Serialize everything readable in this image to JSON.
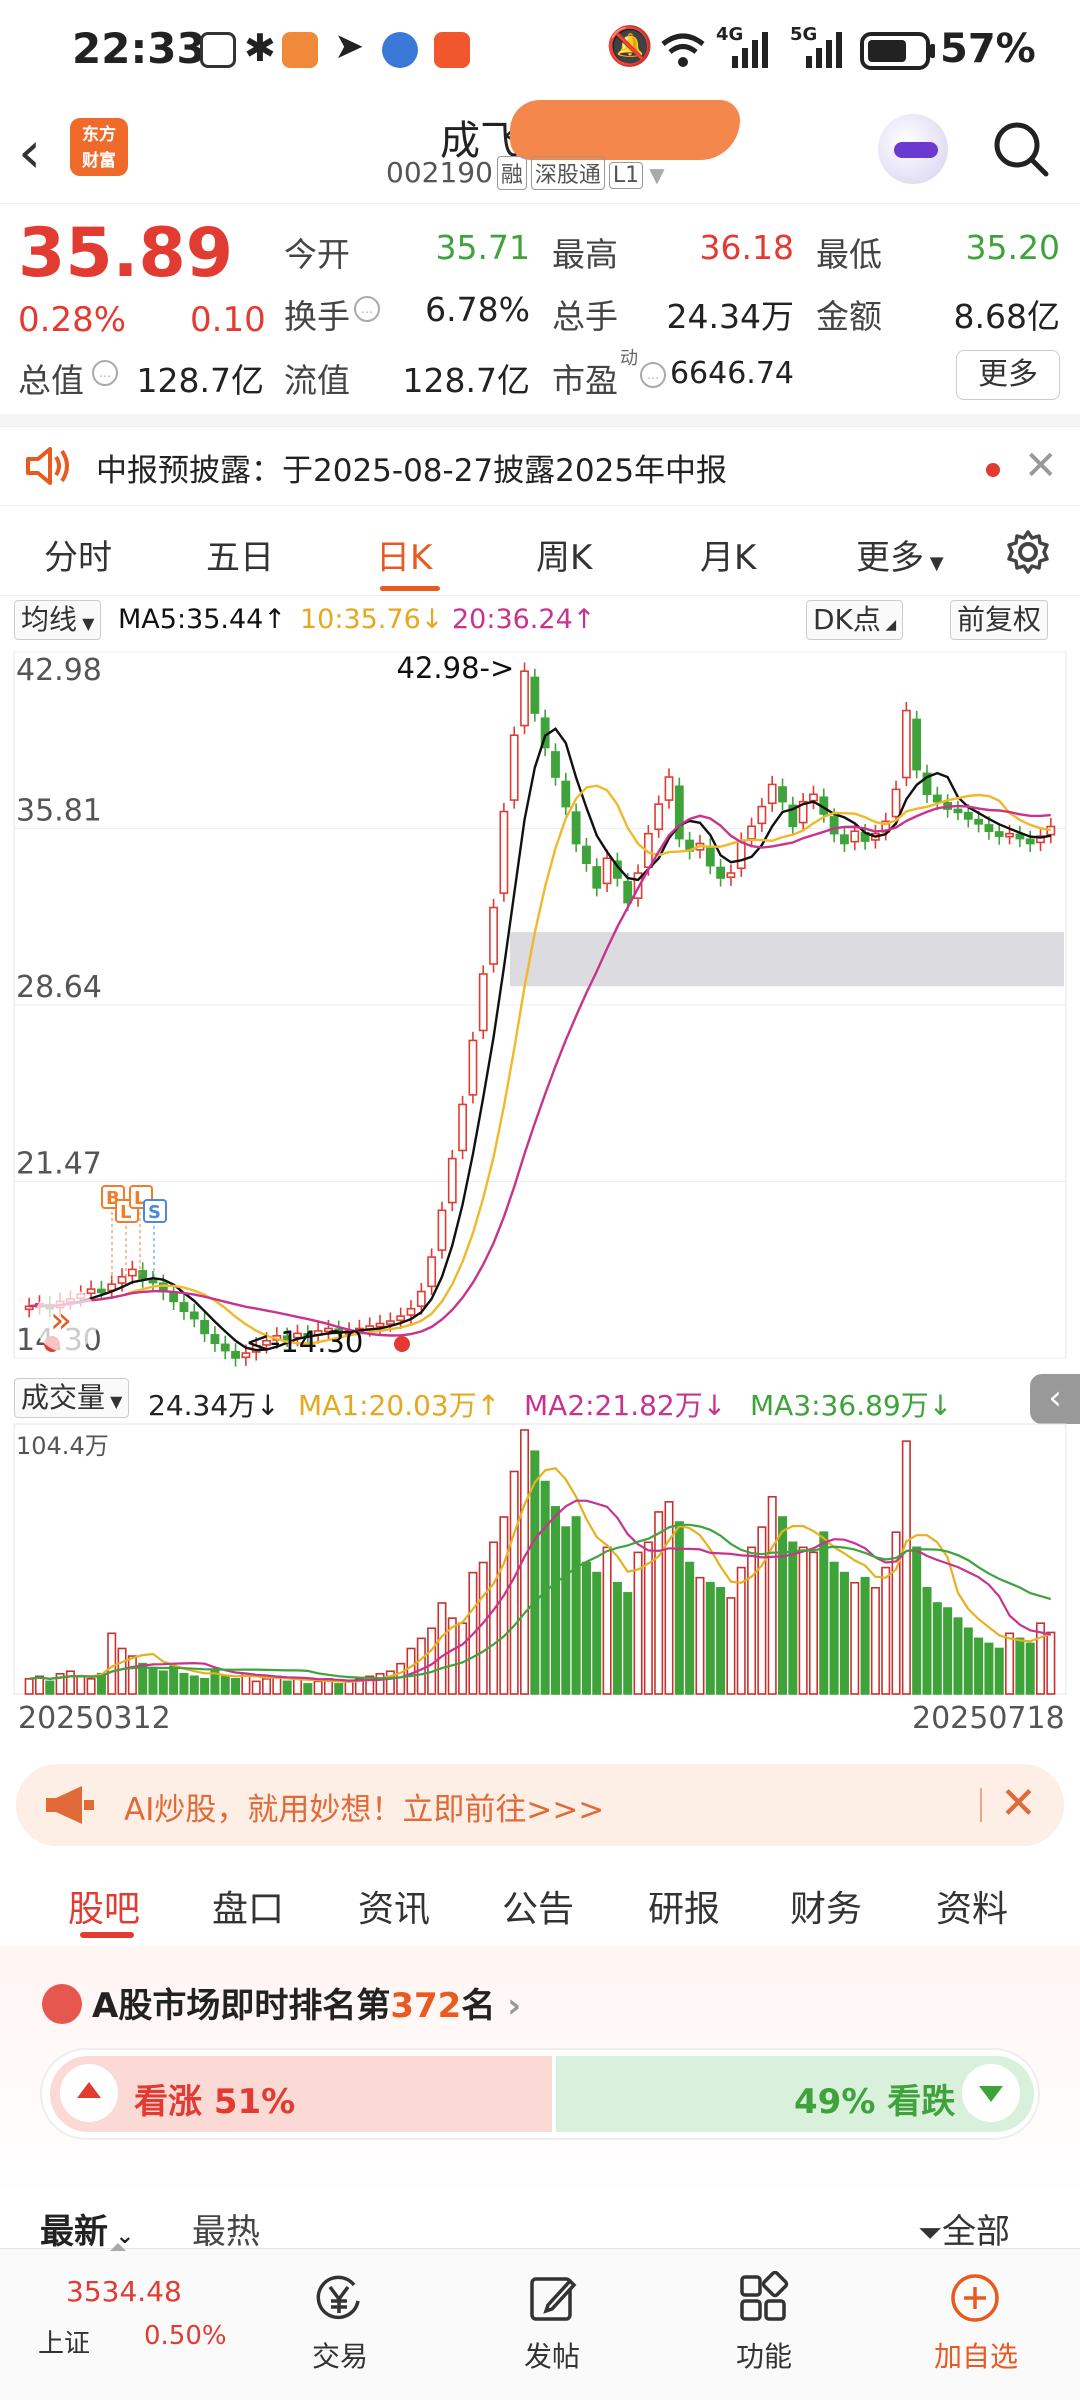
{
  "status_bar": {
    "time": "22:33",
    "network_labels": [
      "4G",
      "5G"
    ],
    "battery": "57%"
  },
  "header": {
    "logo_line1": "东方",
    "logo_line2": "财富",
    "stock_name": "成飞",
    "stock_code": "002190",
    "tags": [
      "融",
      "深股通",
      "L1"
    ]
  },
  "quote": {
    "price": "35.89",
    "change_pct": "0.28%",
    "change": "0.10",
    "open_label": "今开",
    "open": "35.71",
    "high_label": "最高",
    "high": "36.18",
    "low_label": "最低",
    "low": "35.20",
    "turnover_label": "换手",
    "turnover": "6.78%",
    "volume_label": "总手",
    "volume": "24.34万",
    "amount_label": "金额",
    "amount": "8.68亿",
    "mktcap_label": "总值",
    "mktcap": "128.7亿",
    "float_label": "流值",
    "float_cap": "128.7亿",
    "pe_label": "市盈",
    "pe_sup": "动",
    "pe": "6646.74",
    "more": "更多"
  },
  "notice": {
    "text": "中报预披露：于2025-08-27披露2025年中报"
  },
  "period_tabs": [
    "分时",
    "五日",
    "日K",
    "周K",
    "月K",
    "更多"
  ],
  "active_period": "日K",
  "ma_row": {
    "type_label": "均线",
    "ma5": "MA5:35.44",
    "ma10": "10:35.76",
    "ma20": "20:36.24",
    "dk": "DK点",
    "adjust": "前复权"
  },
  "chart_data": [
    {
      "type": "candlestick",
      "y_axis_ticks": [
        "42.98",
        "35.81",
        "28.64",
        "21.47",
        "14.30"
      ],
      "ylim": [
        14.3,
        42.98
      ],
      "x_start": "20250312",
      "x_end": "20250718",
      "max_annotation": "42.98->",
      "min_annotation": "<-14.30",
      "trade_markers": [
        "B",
        "L",
        "L",
        "S"
      ],
      "closes": [
        16.4,
        16.5,
        16.3,
        16.6,
        16.7,
        16.9,
        17.1,
        17.0,
        17.3,
        17.6,
        17.9,
        17.5,
        17.4,
        17.0,
        16.6,
        16.2,
        15.9,
        15.3,
        14.9,
        14.6,
        14.3,
        14.5,
        14.8,
        15.0,
        15.2,
        15.1,
        15.3,
        15.2,
        15.4,
        15.5,
        15.3,
        15.4,
        15.5,
        15.6,
        15.7,
        15.8,
        16.0,
        16.3,
        17.0,
        18.4,
        20.3,
        22.4,
        24.6,
        27.2,
        29.9,
        32.6,
        36.5,
        39.6,
        42.2,
        40.5,
        39.1,
        37.9,
        36.7,
        35.2,
        34.4,
        33.4,
        34.6,
        33.8,
        32.8,
        34.0,
        35.6,
        36.8,
        37.9,
        35.4,
        34.9,
        35.2,
        34.3,
        33.8,
        34.0,
        35.3,
        35.9,
        36.7,
        37.6,
        36.9,
        35.9,
        36.9,
        37.2,
        36.4,
        35.6,
        35.2,
        35.7,
        35.3,
        35.6,
        36.1,
        37.4,
        40.6,
        38.2,
        37.2,
        36.9,
        36.6,
        36.5,
        36.2,
        36.0,
        35.7,
        35.5,
        35.6,
        35.4,
        35.2,
        35.5,
        35.89
      ],
      "ma_series": [
        "MA5",
        "MA10",
        "MA20"
      ]
    },
    {
      "type": "bar",
      "title": "成交量",
      "current": "24.34万",
      "ma1": "MA1:20.03万",
      "ma2": "MA2:21.82万",
      "ma3": "MA3:36.89万",
      "max_label": "104.4万",
      "values": [
        6,
        7,
        5,
        8,
        9,
        7,
        6,
        8,
        24,
        18,
        15,
        12,
        10,
        9,
        11,
        8,
        7,
        6,
        9,
        7,
        6,
        8,
        5,
        6,
        7,
        5,
        6,
        4,
        5,
        6,
        4,
        5,
        6,
        7,
        8,
        9,
        12,
        18,
        22,
        26,
        36,
        30,
        28,
        48,
        52,
        60,
        70,
        88,
        104.4,
        96,
        84,
        74,
        66,
        70,
        52,
        48,
        58,
        44,
        40,
        56,
        60,
        72,
        76,
        68,
        52,
        46,
        44,
        42,
        38,
        50,
        58,
        66,
        78,
        70,
        60,
        58,
        56,
        64,
        52,
        48,
        44,
        46,
        42,
        50,
        64,
        100,
        58,
        42,
        36,
        34,
        30,
        26,
        22,
        20,
        18,
        24,
        22,
        20,
        28,
        24.34
      ],
      "colors": {
        "up": "#c8312f",
        "down": "#3ea338"
      }
    }
  ],
  "ai_banner": {
    "text": "AI炒股，就用妙想！立即前往>>>"
  },
  "lower_tabs": [
    "股吧",
    "盘口",
    "资讯",
    "公告",
    "研报",
    "财务",
    "资料"
  ],
  "ranking": {
    "prefix": "A股市场即时排名第",
    "rank": "372",
    "suffix": "名",
    "bull_label": "看涨 51%",
    "bull_pct": 51,
    "bear_label": "49% 看跌",
    "bear_pct": 49
  },
  "feed_tabs": {
    "latest": "最新",
    "hot": "最热",
    "filter": "全部"
  },
  "bottom_nav": {
    "index_value": "3534.48",
    "index_name": "上证",
    "index_pct": "0.50%",
    "items": [
      "交易",
      "发帖",
      "功能",
      "加自选"
    ]
  },
  "colors": {
    "up": "#e23b32",
    "down": "#3fa33c",
    "accent": "#e85a1f",
    "ma5": "#111111",
    "ma10": "#f0b92a",
    "ma20": "#c8338e"
  }
}
